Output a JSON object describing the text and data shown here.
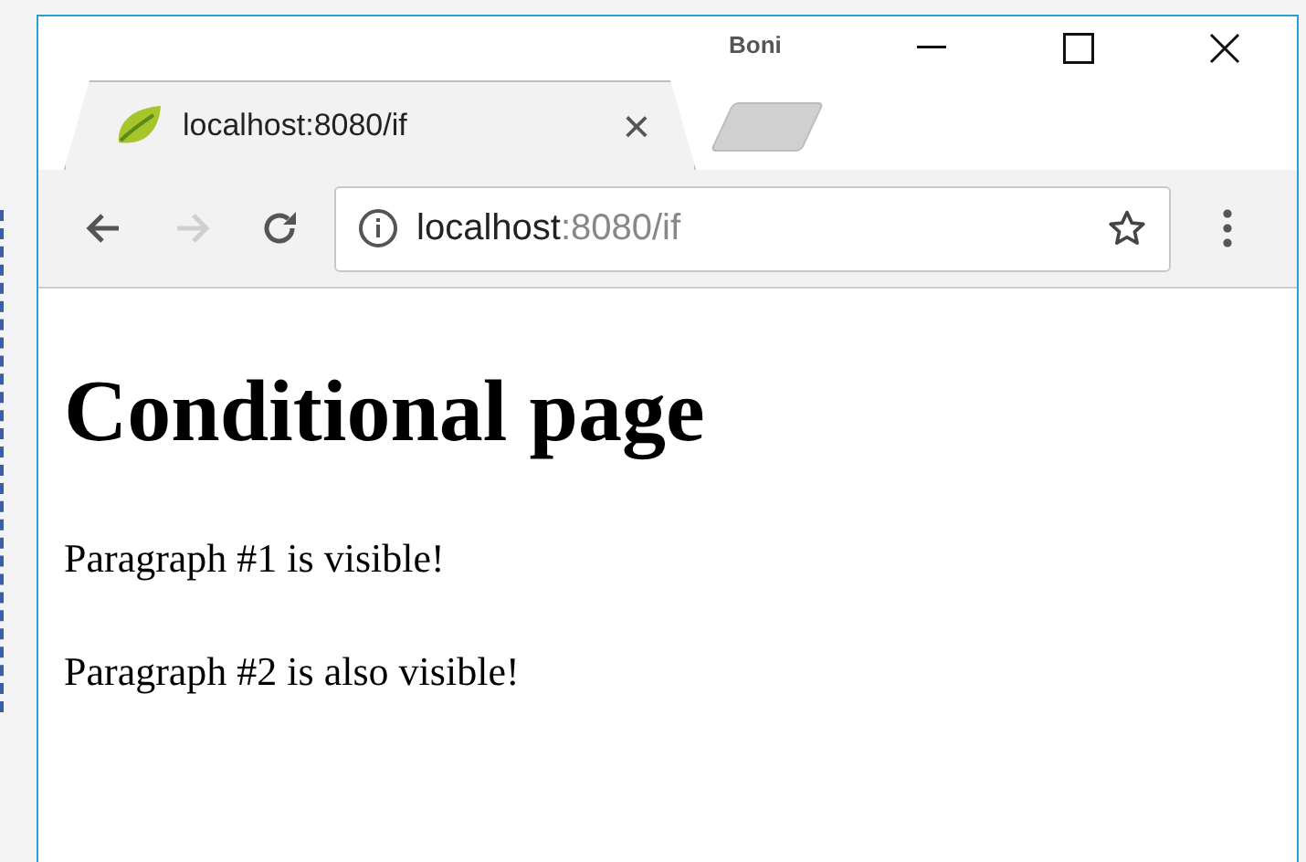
{
  "window": {
    "profile_name": "Boni"
  },
  "tabs": [
    {
      "title": "localhost:8080/if",
      "close": "×",
      "selected": true
    }
  ],
  "nav_buttons": [
    {
      "kind": "back",
      "disabled": false
    },
    {
      "kind": "forward",
      "disabled": true
    },
    {
      "kind": "reload",
      "disabled": false
    }
  ],
  "address_bar": {
    "host": "localhost",
    "path": ":8080/if"
  },
  "page": {
    "heading": "Conditional page",
    "paragraphs": [
      "Paragraph #1 is visible!",
      "Paragraph #2 is also visible!"
    ]
  }
}
